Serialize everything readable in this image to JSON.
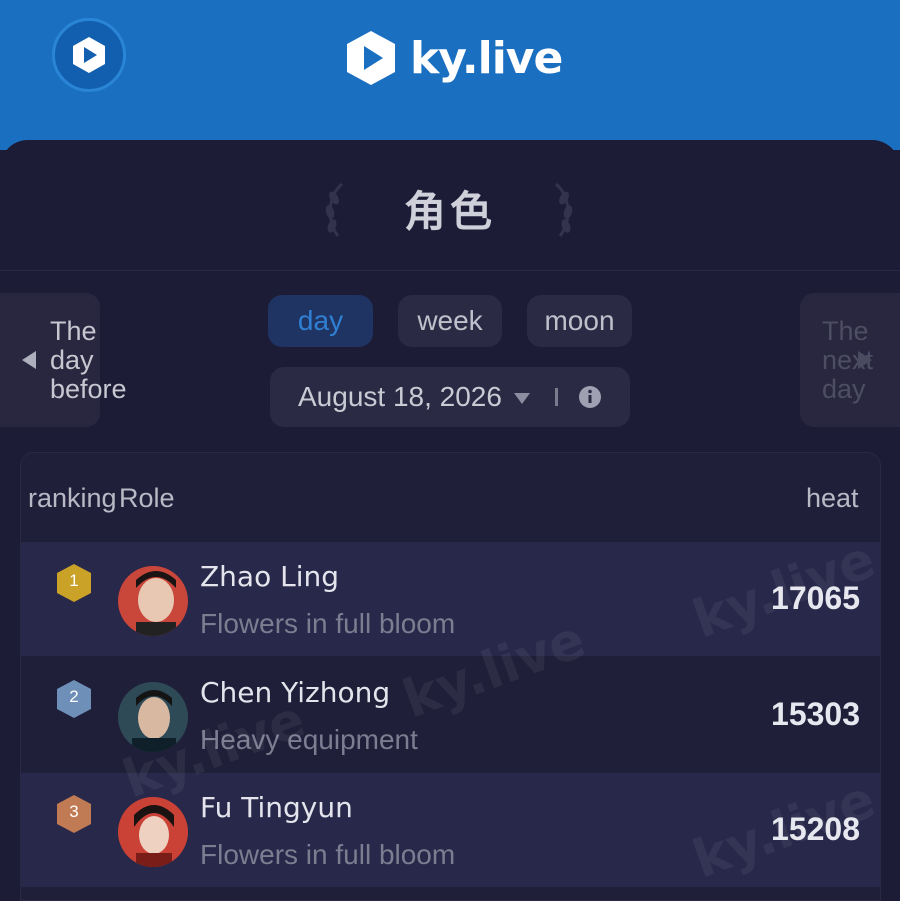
{
  "brand": {
    "name": "ky.live"
  },
  "page": {
    "title": "角色"
  },
  "nav": {
    "prev_label": "The day before",
    "next_label": "The next day"
  },
  "tabs": [
    {
      "label": "day",
      "active": true
    },
    {
      "label": "week",
      "active": false
    },
    {
      "label": "moon",
      "active": false
    }
  ],
  "date_selector": {
    "value": "August 18, 2026"
  },
  "table": {
    "headers": {
      "ranking": "ranking",
      "role": "Role",
      "heat": "heat"
    },
    "rows": [
      {
        "rank": "1",
        "name": "Zhao Ling",
        "role": "Flowers in full bloom",
        "heat": "17065",
        "medal_color": "#c9a227"
      },
      {
        "rank": "2",
        "name": "Chen Yizhong",
        "role": "Heavy equipment",
        "heat": "15303",
        "medal_color": "#6d8fb8"
      },
      {
        "rank": "3",
        "name": "Fu Tingyun",
        "role": "Flowers in full bloom",
        "heat": "15208",
        "medal_color": "#c07a54"
      }
    ]
  },
  "watermark": {
    "text": "ky.live"
  },
  "colors": {
    "header_blue": "#1b6fc1",
    "panel_bg": "#1d1c36",
    "active_tab_text": "#2f7fd2"
  }
}
